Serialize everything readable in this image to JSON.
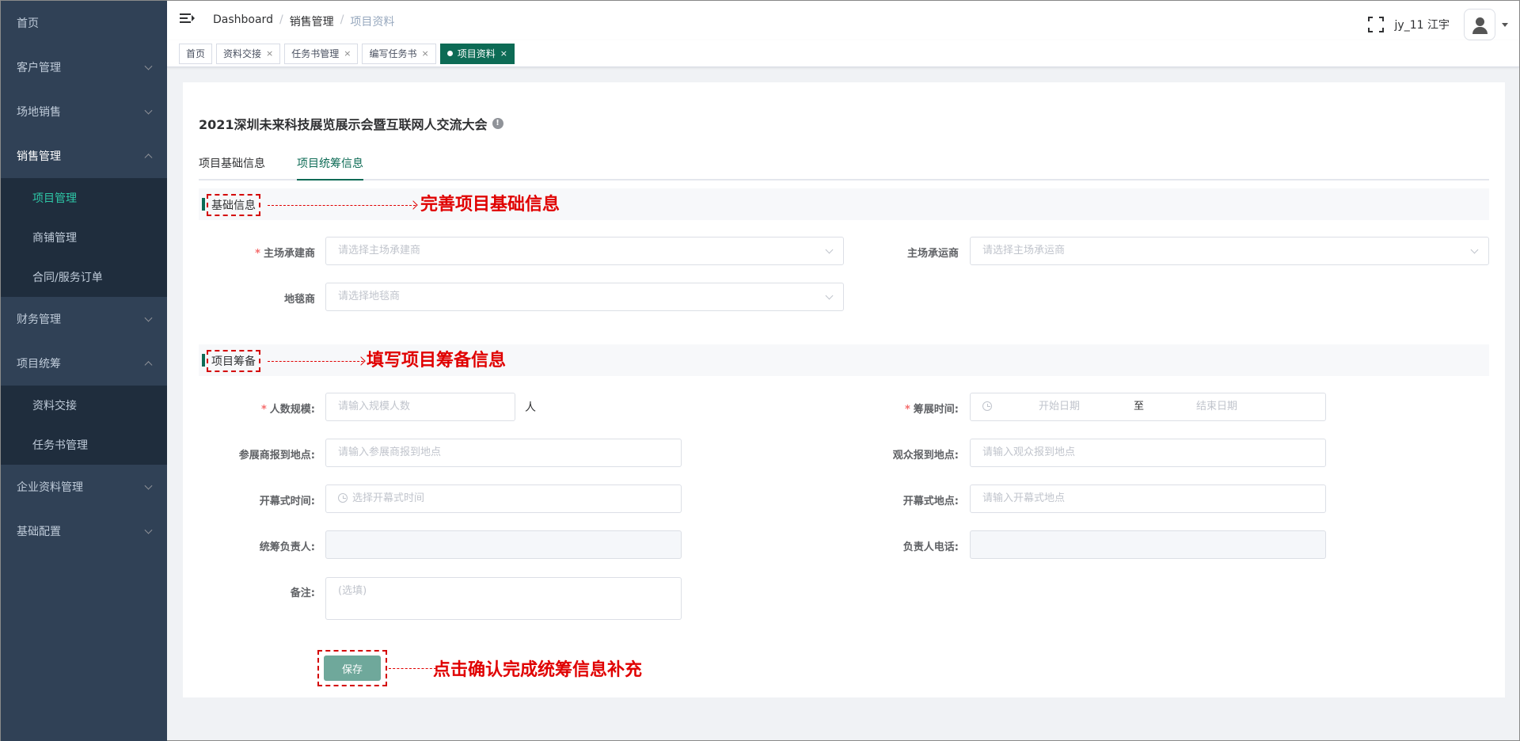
{
  "sidebar": {
    "items": [
      {
        "label": "首页"
      },
      {
        "label": "客户管理"
      },
      {
        "label": "场地销售"
      },
      {
        "label": "销售管理"
      },
      {
        "label": "财务管理"
      },
      {
        "label": "项目统筹"
      },
      {
        "label": "企业资料管理"
      },
      {
        "label": "基础配置"
      }
    ],
    "sales_sub": [
      {
        "label": "项目管理"
      },
      {
        "label": "商铺管理"
      },
      {
        "label": "合同/服务订单"
      }
    ],
    "project_sub": [
      {
        "label": "资料交接"
      },
      {
        "label": "任务书管理"
      }
    ]
  },
  "header": {
    "breadcrumb": [
      "Dashboard",
      "/",
      "销售管理",
      "/",
      "项目资料"
    ],
    "username": "jy_11 江宇"
  },
  "tags": [
    {
      "label": "首页"
    },
    {
      "label": "资料交接",
      "close": "×"
    },
    {
      "label": "任务书管理",
      "close": "×"
    },
    {
      "label": "编写任务书",
      "close": "×"
    },
    {
      "label": "项目资料",
      "close": "×"
    }
  ],
  "page": {
    "title": "2021深圳未来科技展览展示会暨互联网人交流大会",
    "info_icon": "!",
    "tabs": [
      "项目基础信息",
      "项目统筹信息"
    ]
  },
  "section_basic": {
    "label": "基础信息",
    "annotation": "完善项目基础信息",
    "main_builder_label": "主场承建商",
    "main_builder_placeholder": "请选择主场承建商",
    "main_carrier_label": "主场承运商",
    "main_carrier_placeholder": "请选择主场承运商",
    "carpet_label": "地毯商",
    "carpet_placeholder": "请选择地毯商"
  },
  "section_prep": {
    "label": "项目筹备",
    "annotation": "填写项目筹备信息",
    "scale_label": "人数规模:",
    "scale_placeholder": "请输入规模人数",
    "scale_unit": "人",
    "prep_time_label": "筹展时间:",
    "start_placeholder": "开始日期",
    "range_sep": "至",
    "end_placeholder": "结束日期",
    "exhibitor_loc_label": "参展商报到地点:",
    "exhibitor_loc_placeholder": "请输入参展商报到地点",
    "visitor_loc_label": "观众报到地点:",
    "visitor_loc_placeholder": "请输入观众报到地点",
    "opening_time_label": "开幕式时间:",
    "opening_time_placeholder": "选择开幕式时间",
    "opening_loc_label": "开幕式地点:",
    "opening_loc_placeholder": "请输入开幕式地点",
    "coordinator_label": "统筹负责人:",
    "phone_label": "负责人电话:",
    "remark_label": "备注:",
    "remark_placeholder": "(选填)",
    "required_mark": "*"
  },
  "save": {
    "label": "保存",
    "annotation": "点击确认完成统筹信息补充"
  },
  "colors": {
    "accent": "#0d6b55",
    "sidebar_bg": "#304156",
    "annotation": "#e00000"
  }
}
